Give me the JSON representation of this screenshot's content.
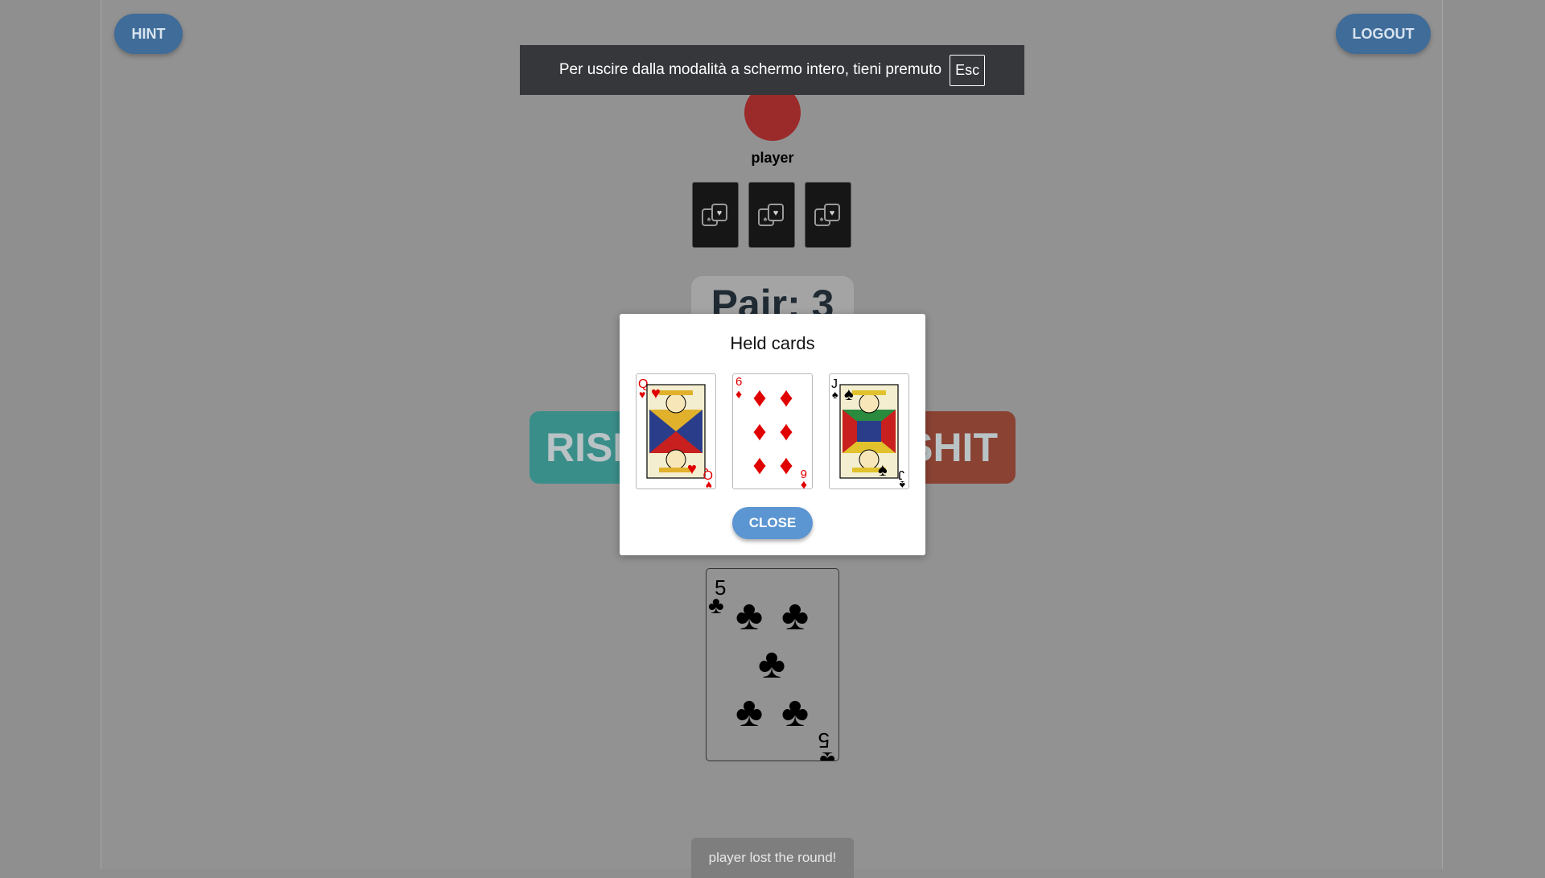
{
  "header": {
    "hint_label": "HINT",
    "logout_label": "LOGOUT"
  },
  "fullscreen_banner": {
    "message": "Per uscire dalla modalità a schermo intero, tieni premuto",
    "key": "Esc"
  },
  "opponent": {
    "name": "player",
    "avatar_color": "#9b2a2a",
    "hidden_cards": 3
  },
  "score_label": "Pair: 3",
  "actions": {
    "rise_label": "RISE",
    "shit_label": "SHIT"
  },
  "modal": {
    "title": "Held cards",
    "close_label": "CLOSE",
    "cards": [
      {
        "rank": "Q",
        "suit": "hearts",
        "suit_glyph": "♥",
        "color": "#e00000"
      },
      {
        "rank": "6",
        "suit": "diamonds",
        "suit_glyph": "♦",
        "color": "#e00000"
      },
      {
        "rank": "J",
        "suit": "spades",
        "suit_glyph": "♠",
        "color": "#000000"
      }
    ]
  },
  "table_card": {
    "rank": "5",
    "suit": "clubs",
    "suit_glyph": "♣",
    "color": "#000000"
  },
  "status_message": "player lost the round!",
  "colors": {
    "overlay": "#929292",
    "hint_button": "#3f6c99",
    "rise_button": "#3a8e8a",
    "shit_button": "#8a4233",
    "close_button": "#5b95d2"
  }
}
